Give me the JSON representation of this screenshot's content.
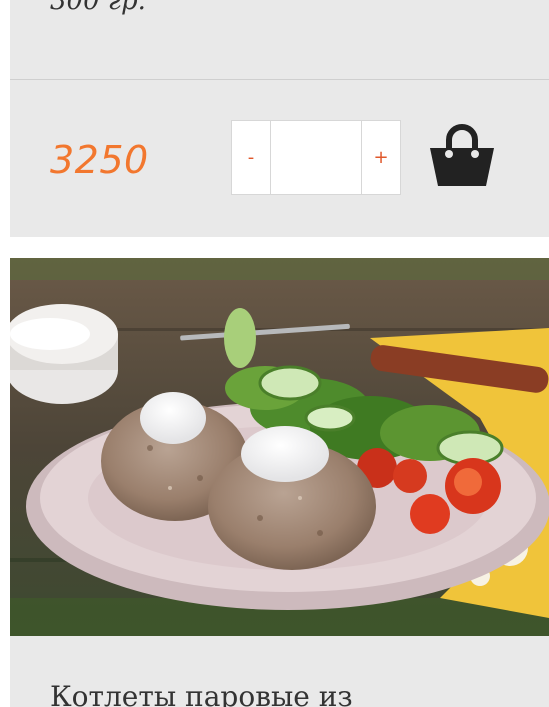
{
  "previous_product": {
    "weight": "300 гр.",
    "price": "3250",
    "quantity": {
      "decrement_label": "-",
      "value": "",
      "increment_label": "+"
    },
    "cart_icon": "shopping-bag-icon"
  },
  "next_product": {
    "image_icon": "cutlets-with-salad-photo",
    "title": "Котлеты паровые из"
  },
  "colors": {
    "price": "#f2772e",
    "stepper_sign": "#e0582b",
    "card_background": "#e9e9e9",
    "cart_icon": "#222222"
  }
}
